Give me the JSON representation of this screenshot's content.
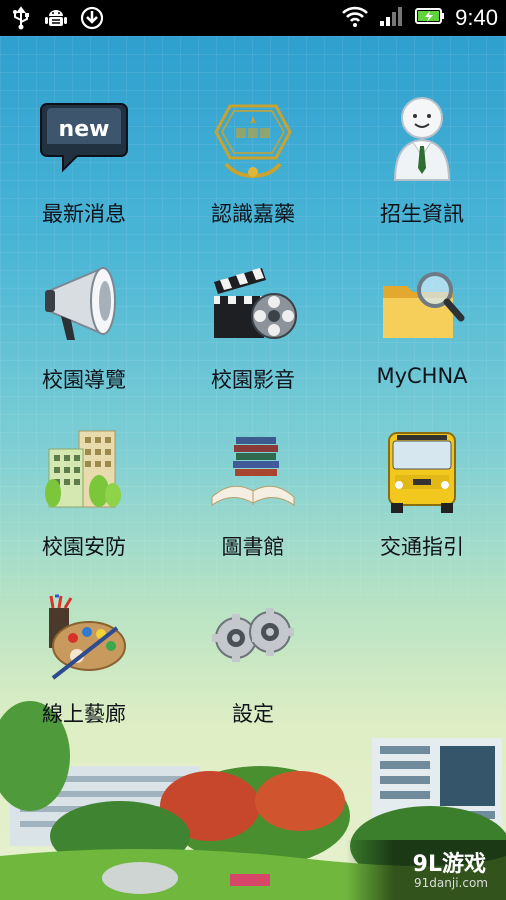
{
  "status_bar": {
    "time": "9:40",
    "left_icons": [
      "usb-icon",
      "android-debug-icon",
      "download-icon"
    ],
    "right_icons": [
      "wifi-icon",
      "signal-icon",
      "battery-charging-icon"
    ],
    "battery_color": "#5fd23c"
  },
  "menu": {
    "items": [
      {
        "label": "最新消息",
        "icon": "new-badge-icon"
      },
      {
        "label": "認識嘉藥",
        "icon": "school-emblem-icon"
      },
      {
        "label": "招生資訊",
        "icon": "person-icon"
      },
      {
        "label": "校園導覽",
        "icon": "megaphone-icon"
      },
      {
        "label": "校園影音",
        "icon": "film-reel-icon"
      },
      {
        "label": "MyCHNA",
        "icon": "folder-search-icon"
      },
      {
        "label": "校園安防",
        "icon": "buildings-icon"
      },
      {
        "label": "圖書館",
        "icon": "books-icon"
      },
      {
        "label": "交通指引",
        "icon": "bus-icon"
      },
      {
        "label": "線上藝廊",
        "icon": "palette-icon"
      },
      {
        "label": "設定",
        "icon": "gears-icon"
      }
    ]
  },
  "watermark": {
    "brand": "9L游戏",
    "url": "91danji.com"
  }
}
